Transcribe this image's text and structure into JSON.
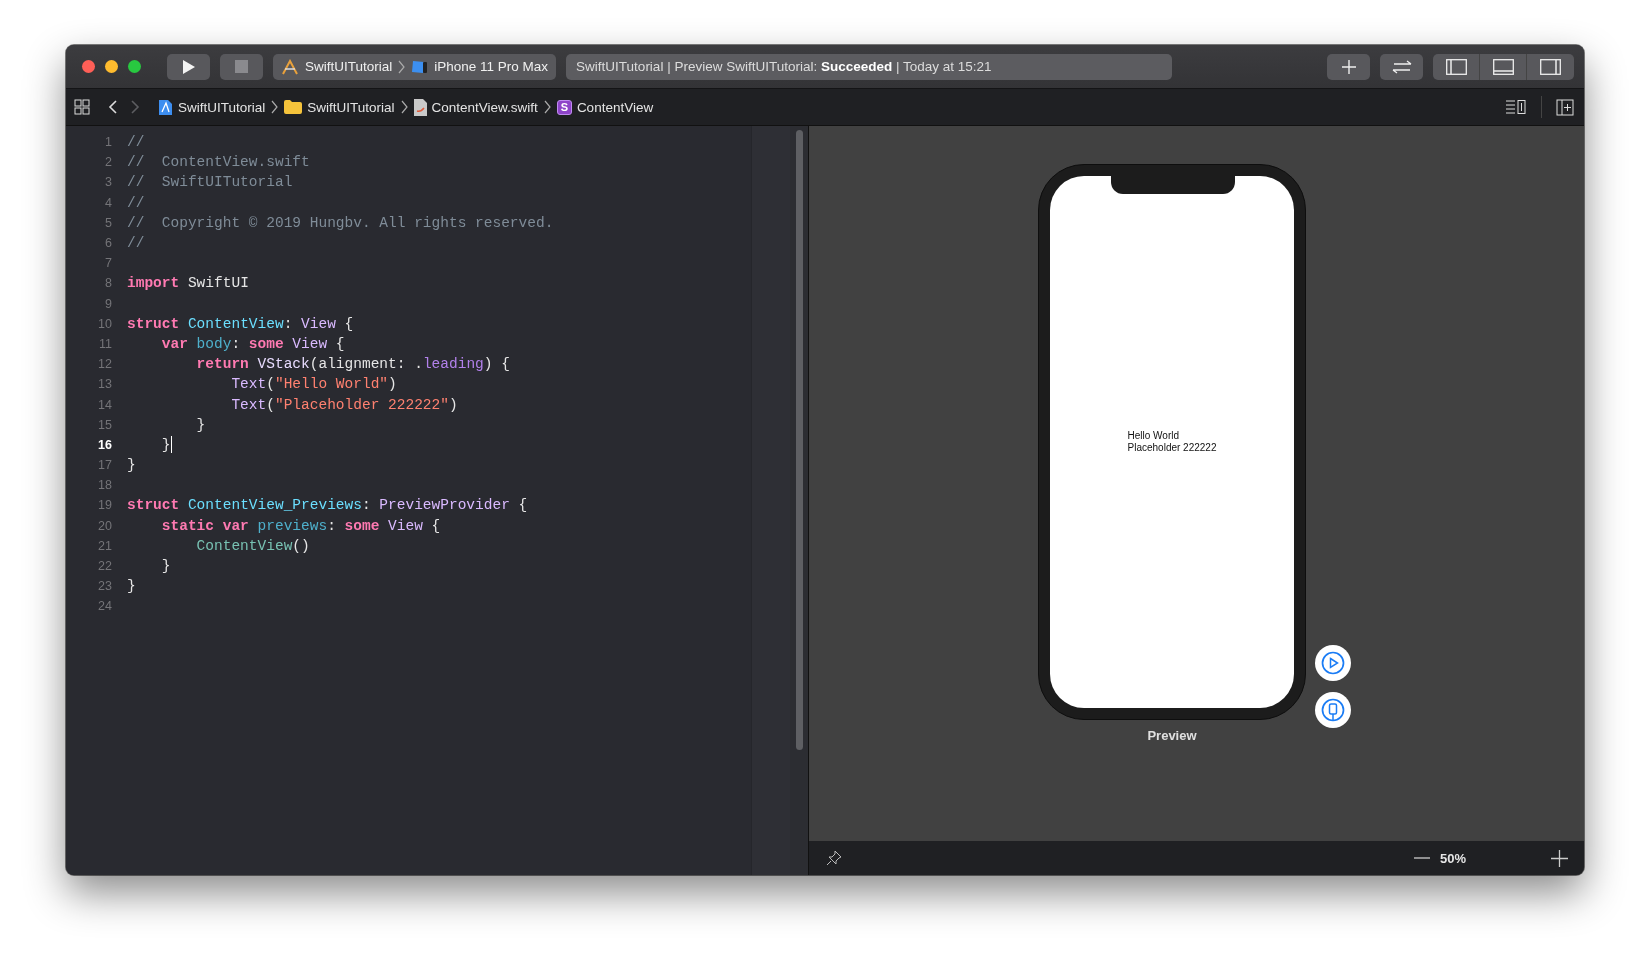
{
  "toolbar": {
    "scheme": "SwiftUITutorial",
    "device": "iPhone 11 Pro Max",
    "status": "SwiftUITutorial | Preview SwiftUITutorial: **Succeeded** | Today at 15:21",
    "panel_toggles": [
      {
        "on": false
      },
      {
        "on": false
      },
      {
        "on": false
      }
    ]
  },
  "nav": {
    "back": {
      "disabled": false
    },
    "forward": {
      "disabled": true
    }
  },
  "breadcrumbs": [
    {
      "kind": "project",
      "label": "SwiftUITutorial"
    },
    {
      "kind": "folder",
      "label": "SwiftUITutorial"
    },
    {
      "kind": "file",
      "label": "ContentView.swift"
    },
    {
      "kind": "struct",
      "badge": "S",
      "label": "ContentView"
    }
  ],
  "editor": {
    "lines": [
      {
        "number": "1",
        "current": false,
        "tokens": [
          {
            "kind": "comment",
            "text": "//"
          }
        ]
      },
      {
        "number": "2",
        "current": false,
        "tokens": [
          {
            "kind": "comment",
            "text": "//  ContentView.swift"
          }
        ]
      },
      {
        "number": "3",
        "current": false,
        "tokens": [
          {
            "kind": "comment",
            "text": "//  SwiftUITutorial"
          }
        ]
      },
      {
        "number": "4",
        "current": false,
        "tokens": [
          {
            "kind": "comment",
            "text": "//"
          }
        ]
      },
      {
        "number": "5",
        "current": false,
        "tokens": [
          {
            "kind": "comment",
            "text": "//  Copyright © 2019 Hungbv. All rights reserved."
          }
        ]
      },
      {
        "number": "6",
        "current": false,
        "tokens": [
          {
            "kind": "comment",
            "text": "//"
          }
        ]
      },
      {
        "number": "7",
        "current": false
      },
      {
        "number": "8",
        "current": false,
        "tokens": [
          {
            "kind": "keyword",
            "text": "import"
          },
          {
            "kind": "plain",
            "text": " SwiftUI"
          }
        ]
      },
      {
        "number": "9",
        "current": false
      },
      {
        "number": "10",
        "current": false,
        "tokens": [
          {
            "kind": "keyword",
            "text": "struct"
          },
          {
            "kind": "decl",
            "text": " ContentView"
          },
          {
            "kind": "plain",
            "text": ": "
          },
          {
            "kind": "type",
            "text": "View"
          },
          {
            "kind": "plain",
            "text": " {"
          }
        ]
      },
      {
        "number": "11",
        "current": false,
        "tokens": [
          {
            "kind": "keyword",
            "text": "    var"
          },
          {
            "kind": "property",
            "text": " body"
          },
          {
            "kind": "plain",
            "text": ": "
          },
          {
            "kind": "keyword",
            "text": "some"
          },
          {
            "kind": "type",
            "text": " View"
          },
          {
            "kind": "plain",
            "text": " {"
          }
        ]
      },
      {
        "number": "12",
        "current": false,
        "tokens": [
          {
            "kind": "keyword",
            "text": "        return"
          },
          {
            "kind": "systype",
            "text": " VStack"
          },
          {
            "kind": "plain",
            "text": "(alignment: ."
          },
          {
            "kind": "member",
            "text": "leading"
          },
          {
            "kind": "plain",
            "text": ") {"
          }
        ]
      },
      {
        "number": "13",
        "current": false,
        "tokens": [
          {
            "kind": "type",
            "text": "            Text"
          },
          {
            "kind": "plain",
            "text": "("
          },
          {
            "kind": "string",
            "text": "\"Hello World\""
          },
          {
            "kind": "plain",
            "text": ")"
          }
        ]
      },
      {
        "number": "14",
        "current": false,
        "tokens": [
          {
            "kind": "type",
            "text": "            Text"
          },
          {
            "kind": "plain",
            "text": "("
          },
          {
            "kind": "string",
            "text": "\"Placeholder 222222\""
          },
          {
            "kind": "plain",
            "text": ")"
          }
        ]
      },
      {
        "number": "15",
        "current": false,
        "tokens": [
          {
            "kind": "plain",
            "text": "        }"
          }
        ]
      },
      {
        "number": "16",
        "current": true,
        "tokens": [
          {
            "kind": "plain",
            "text": "    }"
          }
        ]
      },
      {
        "number": "17",
        "current": false,
        "tokens": [
          {
            "kind": "plain",
            "text": "}"
          }
        ]
      },
      {
        "number": "18",
        "current": false
      },
      {
        "number": "19",
        "current": false,
        "tokens": [
          {
            "kind": "keyword",
            "text": "struct"
          },
          {
            "kind": "decl",
            "text": " ContentView_Previews"
          },
          {
            "kind": "plain",
            "text": ": "
          },
          {
            "kind": "type",
            "text": "PreviewProvider"
          },
          {
            "kind": "plain",
            "text": " {"
          }
        ]
      },
      {
        "number": "20",
        "current": false,
        "tokens": [
          {
            "kind": "keyword",
            "text": "    static var"
          },
          {
            "kind": "property",
            "text": " previews"
          },
          {
            "kind": "plain",
            "text": ": "
          },
          {
            "kind": "keyword",
            "text": "some"
          },
          {
            "kind": "type",
            "text": " View"
          },
          {
            "kind": "plain",
            "text": " {"
          }
        ]
      },
      {
        "number": "21",
        "current": false,
        "tokens": [
          {
            "kind": "project",
            "text": "        ContentView"
          },
          {
            "kind": "plain",
            "text": "()"
          }
        ]
      },
      {
        "number": "22",
        "current": false,
        "tokens": [
          {
            "kind": "plain",
            "text": "    }"
          }
        ]
      },
      {
        "number": "23",
        "current": false,
        "tokens": [
          {
            "kind": "plain",
            "text": "}"
          }
        ]
      },
      {
        "number": "24",
        "current": false
      }
    ]
  },
  "preview": {
    "screen_lines": [
      "Hello World",
      "Placeholder 222222"
    ],
    "label": "Preview",
    "zoom": "50%"
  }
}
